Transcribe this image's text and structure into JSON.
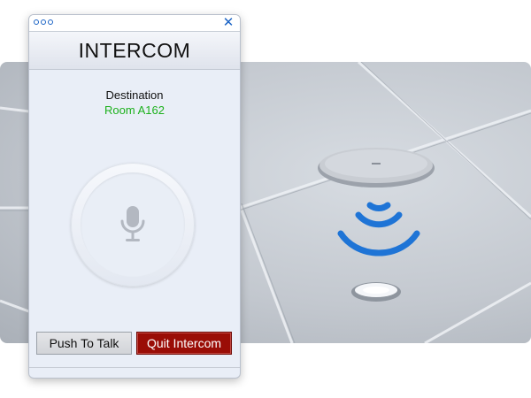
{
  "window": {
    "title": "INTERCOM",
    "destination_label": "Destination",
    "destination_value": "Room A162"
  },
  "icons": {
    "window_menu": "three-dots-icon",
    "close": "close-icon",
    "microphone": "microphone-icon",
    "wireless": "wireless-signal-icon"
  },
  "buttons": {
    "push_to_talk": "Push To Talk",
    "quit_intercom": "Quit Intercom"
  },
  "colors": {
    "accent": "#1a63c5",
    "destination_text": "#1db11d",
    "quit_button": "#9a0d06",
    "signal": "#1e74d6"
  }
}
